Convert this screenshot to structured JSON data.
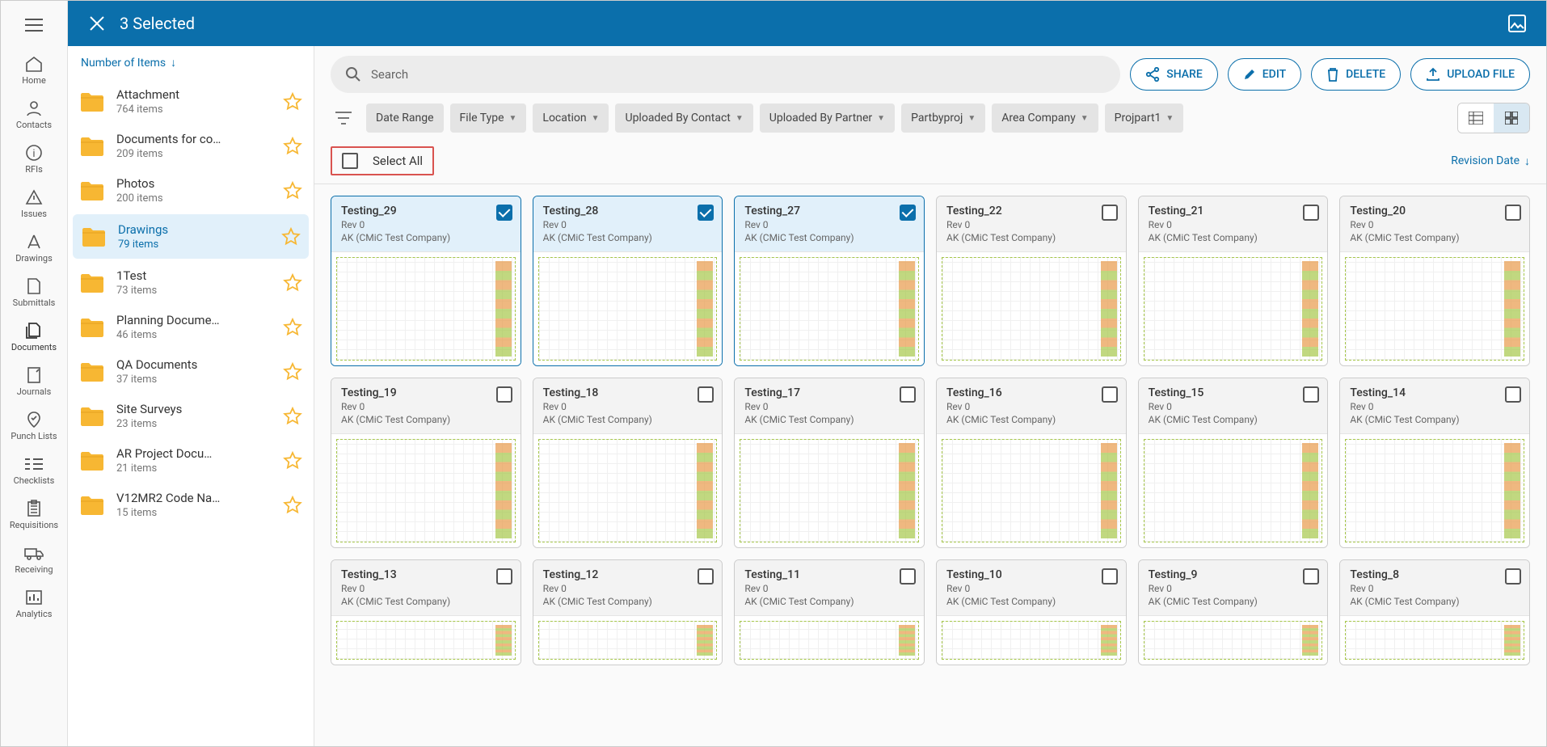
{
  "header": {
    "title": "3 Selected"
  },
  "rail": [
    {
      "key": "home",
      "label": "Home"
    },
    {
      "key": "contacts",
      "label": "Contacts"
    },
    {
      "key": "rfis",
      "label": "RFIs"
    },
    {
      "key": "issues",
      "label": "Issues"
    },
    {
      "key": "drawings",
      "label": "Drawings"
    },
    {
      "key": "submittals",
      "label": "Submittals"
    },
    {
      "key": "documents",
      "label": "Documents",
      "active": true
    },
    {
      "key": "journals",
      "label": "Journals"
    },
    {
      "key": "punchlists",
      "label": "Punch Lists"
    },
    {
      "key": "checklists",
      "label": "Checklists"
    },
    {
      "key": "requisitions",
      "label": "Requisitions"
    },
    {
      "key": "receiving",
      "label": "Receiving"
    },
    {
      "key": "analytics",
      "label": "Analytics"
    }
  ],
  "folderSort": {
    "label": "Number of Items"
  },
  "folders": [
    {
      "name": "Attachment",
      "count": "764 items"
    },
    {
      "name": "Documents for co…",
      "count": "209 items"
    },
    {
      "name": "Photos",
      "count": "200 items"
    },
    {
      "name": "Drawings",
      "count": "79 items",
      "active": true
    },
    {
      "name": "1Test",
      "count": "73 items"
    },
    {
      "name": "Planning Docume…",
      "count": "46 items"
    },
    {
      "name": "QA Documents",
      "count": "37 items"
    },
    {
      "name": "Site Surveys",
      "count": "23 items"
    },
    {
      "name": "AR Project Docu…",
      "count": "21 items"
    },
    {
      "name": "V12MR2 Code Na…",
      "count": "15 items"
    }
  ],
  "search": {
    "placeholder": "Search"
  },
  "actions": {
    "share": "SHARE",
    "edit": "EDIT",
    "delete": "DELETE",
    "upload": "UPLOAD FILE"
  },
  "filters": [
    {
      "label": "Date Range",
      "dd": false
    },
    {
      "label": "File Type",
      "dd": true
    },
    {
      "label": "Location",
      "dd": true
    },
    {
      "label": "Uploaded By Contact",
      "dd": true
    },
    {
      "label": "Uploaded By Partner",
      "dd": true
    },
    {
      "label": "Partbyproj",
      "dd": true
    },
    {
      "label": "Area Company",
      "dd": true
    },
    {
      "label": "Projpart1",
      "dd": true
    }
  ],
  "selectAll": {
    "label": "Select All"
  },
  "gridSort": {
    "label": "Revision Date"
  },
  "cards": [
    {
      "title": "Testing_29",
      "rev": "Rev 0",
      "company": "AK (CMiC Test Company)",
      "selected": true
    },
    {
      "title": "Testing_28",
      "rev": "Rev 0",
      "company": "AK (CMiC Test Company)",
      "selected": true
    },
    {
      "title": "Testing_27",
      "rev": "Rev 0",
      "company": "AK (CMiC Test Company)",
      "selected": true
    },
    {
      "title": "Testing_22",
      "rev": "Rev 0",
      "company": "AK (CMiC Test Company)",
      "selected": false
    },
    {
      "title": "Testing_21",
      "rev": "Rev 0",
      "company": "AK (CMiC Test Company)",
      "selected": false
    },
    {
      "title": "Testing_20",
      "rev": "Rev 0",
      "company": "AK (CMiC Test Company)",
      "selected": false
    },
    {
      "title": "Testing_19",
      "rev": "Rev 0",
      "company": "AK (CMiC Test Company)",
      "selected": false
    },
    {
      "title": "Testing_18",
      "rev": "Rev 0",
      "company": "AK (CMiC Test Company)",
      "selected": false
    },
    {
      "title": "Testing_17",
      "rev": "Rev 0",
      "company": "AK (CMiC Test Company)",
      "selected": false
    },
    {
      "title": "Testing_16",
      "rev": "Rev 0",
      "company": "AK (CMiC Test Company)",
      "selected": false
    },
    {
      "title": "Testing_15",
      "rev": "Rev 0",
      "company": "AK (CMiC Test Company)",
      "selected": false
    },
    {
      "title": "Testing_14",
      "rev": "Rev 0",
      "company": "AK (CMiC Test Company)",
      "selected": false
    },
    {
      "title": "Testing_13",
      "rev": "Rev 0",
      "company": "AK (CMiC Test Company)",
      "selected": false
    },
    {
      "title": "Testing_12",
      "rev": "Rev 0",
      "company": "AK (CMiC Test Company)",
      "selected": false
    },
    {
      "title": "Testing_11",
      "rev": "Rev 0",
      "company": "AK (CMiC Test Company)",
      "selected": false
    },
    {
      "title": "Testing_10",
      "rev": "Rev 0",
      "company": "AK (CMiC Test Company)",
      "selected": false
    },
    {
      "title": "Testing_9",
      "rev": "Rev 0",
      "company": "AK (CMiC Test Company)",
      "selected": false
    },
    {
      "title": "Testing_8",
      "rev": "Rev 0",
      "company": "AK (CMiC Test Company)",
      "selected": false
    }
  ]
}
